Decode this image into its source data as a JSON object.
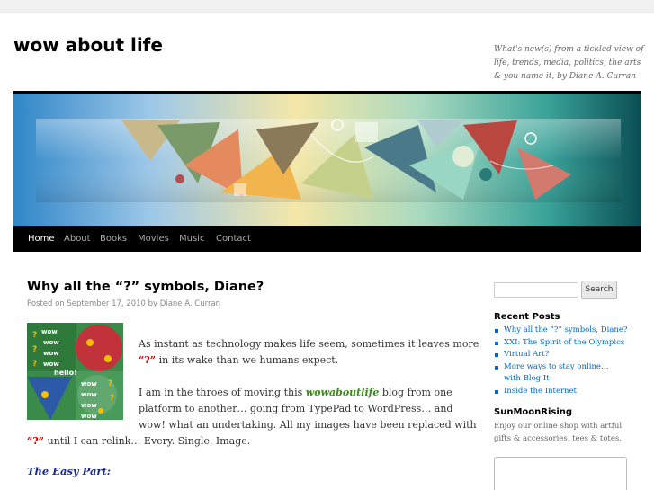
{
  "site": {
    "title": "wow about life",
    "description": "What's new(s) from a tickled view of life, trends, media, politics, the arts & you name it, by Diane A. Curran"
  },
  "nav": {
    "items": [
      {
        "label": "Home",
        "active": true
      },
      {
        "label": "About",
        "active": false
      },
      {
        "label": "Books",
        "active": false
      },
      {
        "label": "Movies",
        "active": false
      },
      {
        "label": "Music",
        "active": false
      },
      {
        "label": "Contact",
        "active": false
      }
    ]
  },
  "post": {
    "title": "Why all the “?” symbols, Diane?",
    "meta": {
      "posted_on": "Posted on",
      "date": "September 17, 2010",
      "by": "by",
      "author": "Diane A. Curran"
    },
    "p1": {
      "line1": "As instant as technology makes life seem, sometimes it leaves more",
      "q": "“?”",
      "line2_rest": " in its wake than we humans expect."
    },
    "p2": {
      "line1_pre": "I am in the throes of moving this ",
      "blog_name": "wowaboutlife",
      "line1_post": " blog from one",
      "line2": "platform to another… going from TypePad to WordPress… and",
      "line3": "wow! what an undertaking. All my images have been replaced with",
      "q": "“?”",
      "line4_rest": " until I can relink… Every. Single. Image."
    },
    "subhead": "The Easy Part:",
    "thumbnail_words": [
      "wow",
      "wow",
      "wow",
      "wow",
      "hello!",
      "wow",
      "wow",
      "wow",
      "wow"
    ]
  },
  "sidebar": {
    "search_button": "Search",
    "search_placeholder": "",
    "recent_posts_title": "Recent Posts",
    "recent_posts": [
      "Why all the “?” symbols, Diane?",
      "XXI: The Spirit of the Olympics",
      "Virtual Art?",
      "More ways to stay online… with Blog It",
      "Inside the Internet"
    ],
    "sunmoon_title": "SunMoonRising",
    "sunmoon_text": "Enjoy our online shop with artful gifts & accessories, tees & totes."
  },
  "colors": {
    "nav_bg": "#000000",
    "accent_red": "#cc0000",
    "link_blue": "#0066cc",
    "blog_name_green": "#3a8a1a",
    "subhead_blue": "#1a2a88"
  }
}
